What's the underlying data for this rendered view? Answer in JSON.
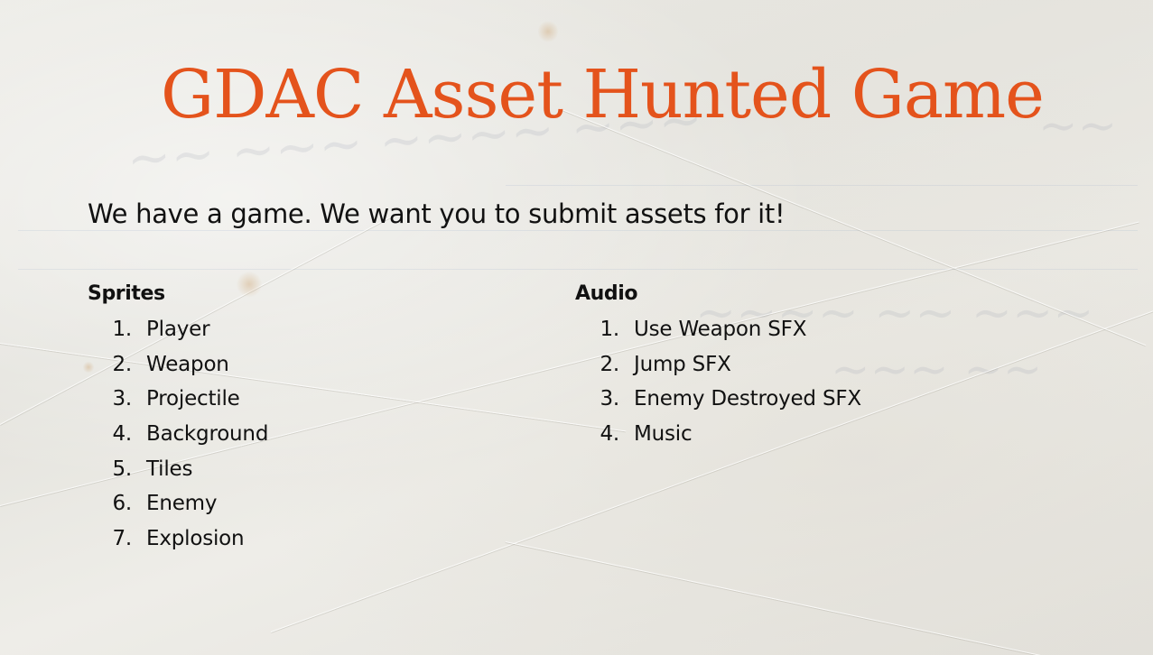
{
  "slide": {
    "title": "GDAC Asset Hunted Game",
    "subtitle": "We have a game. We want you to submit assets for it!",
    "title_color": "#e4531c",
    "text_color": "#111111",
    "background": "crumpled-paper-texture"
  },
  "sections": [
    {
      "heading": "Sprites",
      "items": [
        {
          "num": "1.",
          "label": "Player"
        },
        {
          "num": "2.",
          "label": "Weapon"
        },
        {
          "num": "3.",
          "label": "Projectile"
        },
        {
          "num": "4.",
          "label": "Background"
        },
        {
          "num": "5.",
          "label": "Tiles"
        },
        {
          "num": "6.",
          "label": "Enemy"
        },
        {
          "num": "7.",
          "label": "Explosion"
        }
      ]
    },
    {
      "heading": "Audio",
      "items": [
        {
          "num": "1.",
          "label": "Use Weapon SFX"
        },
        {
          "num": "2.",
          "label": "Jump SFX"
        },
        {
          "num": "3.",
          "label": "Enemy Destroyed SFX"
        },
        {
          "num": "4.",
          "label": "Music"
        }
      ]
    }
  ]
}
